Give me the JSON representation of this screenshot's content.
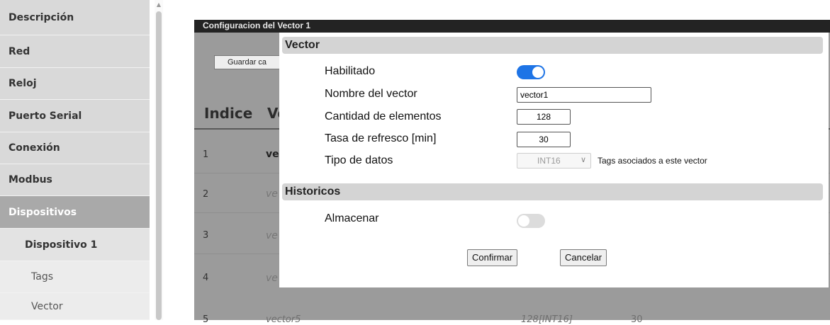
{
  "sidebar": {
    "items": [
      {
        "label": "Descripción"
      },
      {
        "label": "Red"
      },
      {
        "label": "Reloj"
      },
      {
        "label": "Puerto Serial"
      },
      {
        "label": "Conexión"
      },
      {
        "label": "Modbus"
      },
      {
        "label": "Dispositivos"
      },
      {
        "label": "Dispositivo 1"
      },
      {
        "label": "Tags"
      },
      {
        "label": "Vector"
      }
    ]
  },
  "background": {
    "title": "Configuracion del Vector 1",
    "save_button": "Guardar ca",
    "col_index": "Indice",
    "col_name": "Ve",
    "rows": [
      {
        "index": "1",
        "name": "ve"
      },
      {
        "index": "2",
        "name": "ve"
      },
      {
        "index": "3",
        "name": "ve"
      },
      {
        "index": "4",
        "name": "ve"
      },
      {
        "index": "5",
        "name": "vector5"
      }
    ],
    "row5_elements": "128[INT16]",
    "row5_rate": "30"
  },
  "modal": {
    "vector_section": "Vector",
    "habilitado_label": "Habilitado",
    "habilitado_value": true,
    "nombre_label": "Nombre del vector",
    "nombre_value": "vector1",
    "cantidad_label": "Cantidad de elementos",
    "cantidad_value": "128",
    "tasa_label": "Tasa de refresco [min]",
    "tasa_value": "30",
    "tipo_label": "Tipo de datos",
    "tipo_value": "INT16",
    "tags_note": "Tags asociados a este vector",
    "historicos_section": "Historicos",
    "almacenar_label": "Almacenar",
    "almacenar_value": false,
    "confirm_button": "Confirmar",
    "cancel_button": "Cancelar"
  },
  "colors": {
    "accent": "#1e74e6",
    "active_nav": "#a9a9a9",
    "section_header": "#d4d4d4",
    "overlay": "#9b9b9b"
  }
}
